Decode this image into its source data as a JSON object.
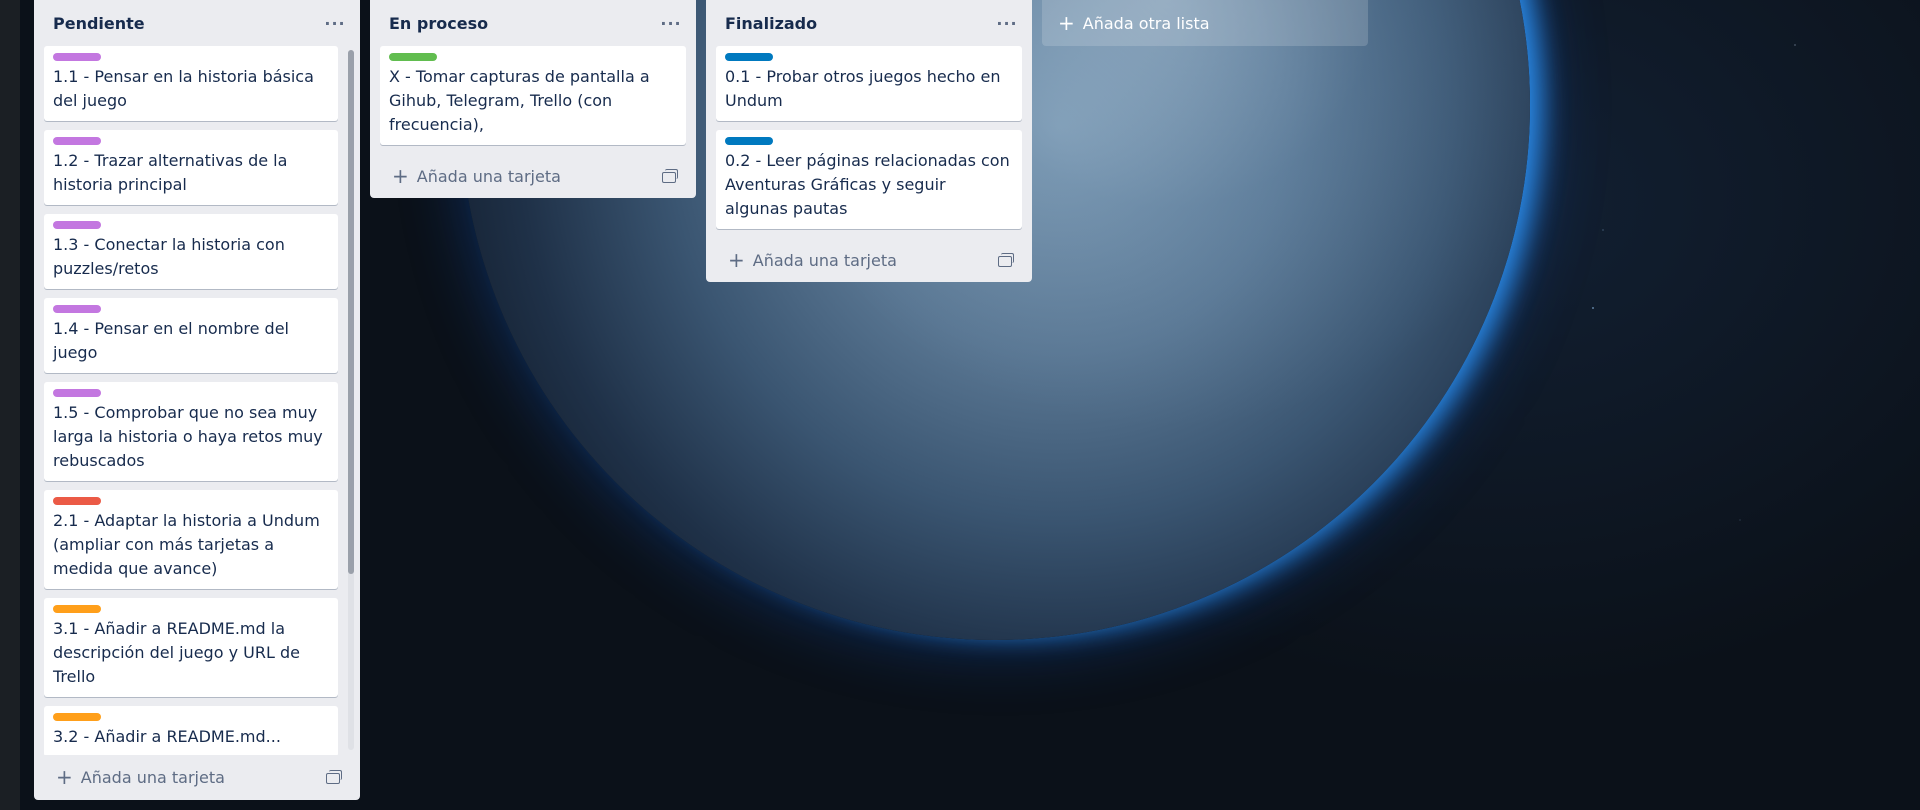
{
  "colors": {
    "label_purple": "#c377e0",
    "label_green": "#61bd4f",
    "label_blue": "#0079bf",
    "label_red": "#eb5a46",
    "label_orange": "#ff9f1a",
    "list_bg": "#ebecf0"
  },
  "lists": [
    {
      "title": "Pendiente",
      "cards": [
        {
          "label_color": "#c377e0",
          "text": "1.1 - Pensar en la historia básica del juego"
        },
        {
          "label_color": "#c377e0",
          "text": "1.2 - Trazar alternativas de la historia principal"
        },
        {
          "label_color": "#c377e0",
          "text": "1.3 - Conectar la historia con puzzles/retos"
        },
        {
          "label_color": "#c377e0",
          "text": "1.4 - Pensar en el nombre del juego"
        },
        {
          "label_color": "#c377e0",
          "text": "1.5 - Comprobar que no sea muy larga la historia o haya retos muy rebuscados"
        },
        {
          "label_color": "#eb5a46",
          "text": "2.1 - Adaptar la historia a Undum (ampliar con más tarjetas a medida que avance)"
        },
        {
          "label_color": "#ff9f1a",
          "text": "3.1 - Añadir a README.md la descripción del juego y URL de Trello"
        },
        {
          "label_color": "#ff9f1a",
          "text": "3.2 - Añadir a README.md..."
        }
      ],
      "add_card_label": "Añada una tarjeta"
    },
    {
      "title": "En proceso",
      "cards": [
        {
          "label_color": "#61bd4f",
          "text": "X - Tomar capturas de pantalla a Gihub, Telegram, Trello (con frecuencia),"
        }
      ],
      "add_card_label": "Añada una tarjeta"
    },
    {
      "title": "Finalizado",
      "cards": [
        {
          "label_color": "#0079bf",
          "text": "0.1 - Probar otros juegos hecho en Undum"
        },
        {
          "label_color": "#0079bf",
          "text": "0.2 - Leer páginas relacionadas con Aventuras Gráficas y seguir algunas pautas"
        }
      ],
      "add_card_label": "Añada una tarjeta"
    }
  ],
  "add_list_label": "Añada otra lista",
  "icons": {
    "list_menu": "ellipsis-icon",
    "add": "plus-icon",
    "template": "card-template-icon"
  }
}
